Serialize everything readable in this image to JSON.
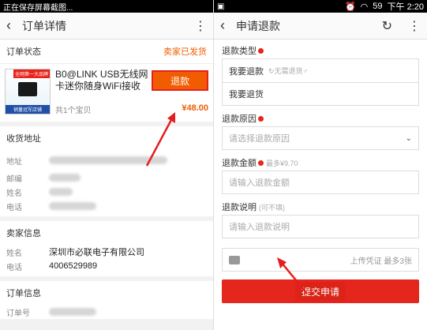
{
  "left": {
    "statusbar_text": "正在保存屏幕截图...",
    "title": "订单详情",
    "order_status_label": "订单状态",
    "order_status_value": "卖家已发货",
    "product": {
      "thumb_tag": "全网第一大品牌",
      "thumb_foot": "销量冠军店铺",
      "name": "B0@LINK USB无线网卡迷你随身WiFi接收发...",
      "count": "共1个宝贝",
      "refund_button": "退款",
      "price": "¥48.00"
    },
    "shipping": {
      "heading": "收货地址",
      "rows": [
        {
          "label": "地址"
        },
        {
          "label": "邮编"
        },
        {
          "label": "姓名"
        },
        {
          "label": "电话"
        }
      ]
    },
    "seller": {
      "heading": "卖家信息",
      "rows": [
        {
          "label": "姓名",
          "value": "深圳市必联电子有限公司"
        },
        {
          "label": "电话",
          "value": "4006529989"
        }
      ]
    },
    "order_info": {
      "heading": "订单信息",
      "rows": [
        {
          "label": "订单号"
        }
      ]
    }
  },
  "right": {
    "time": "下午 2:20",
    "battery": "59",
    "title": "申请退款",
    "refund_type_label": "退款类型",
    "refund_type_options": [
      {
        "label": "我要退款",
        "hint": "↻无需退货♂"
      },
      {
        "label": "我要退货",
        "hint": ""
      }
    ],
    "reason_label": "退款原因",
    "reason_placeholder": "请选择退款原因",
    "amount_label": "退款金额",
    "amount_hint": "最多¥9.70",
    "amount_placeholder": "请输入退款金额",
    "desc_label": "退款说明",
    "desc_hint": "(可不填)",
    "desc_placeholder": "请输入退款说明",
    "upload_text": "上传凭证 最多3张",
    "submit_label": "提交申请"
  },
  "colors": {
    "accent": "#f25c00",
    "submit": "#e5261d",
    "arrow": "#e51f1f"
  }
}
